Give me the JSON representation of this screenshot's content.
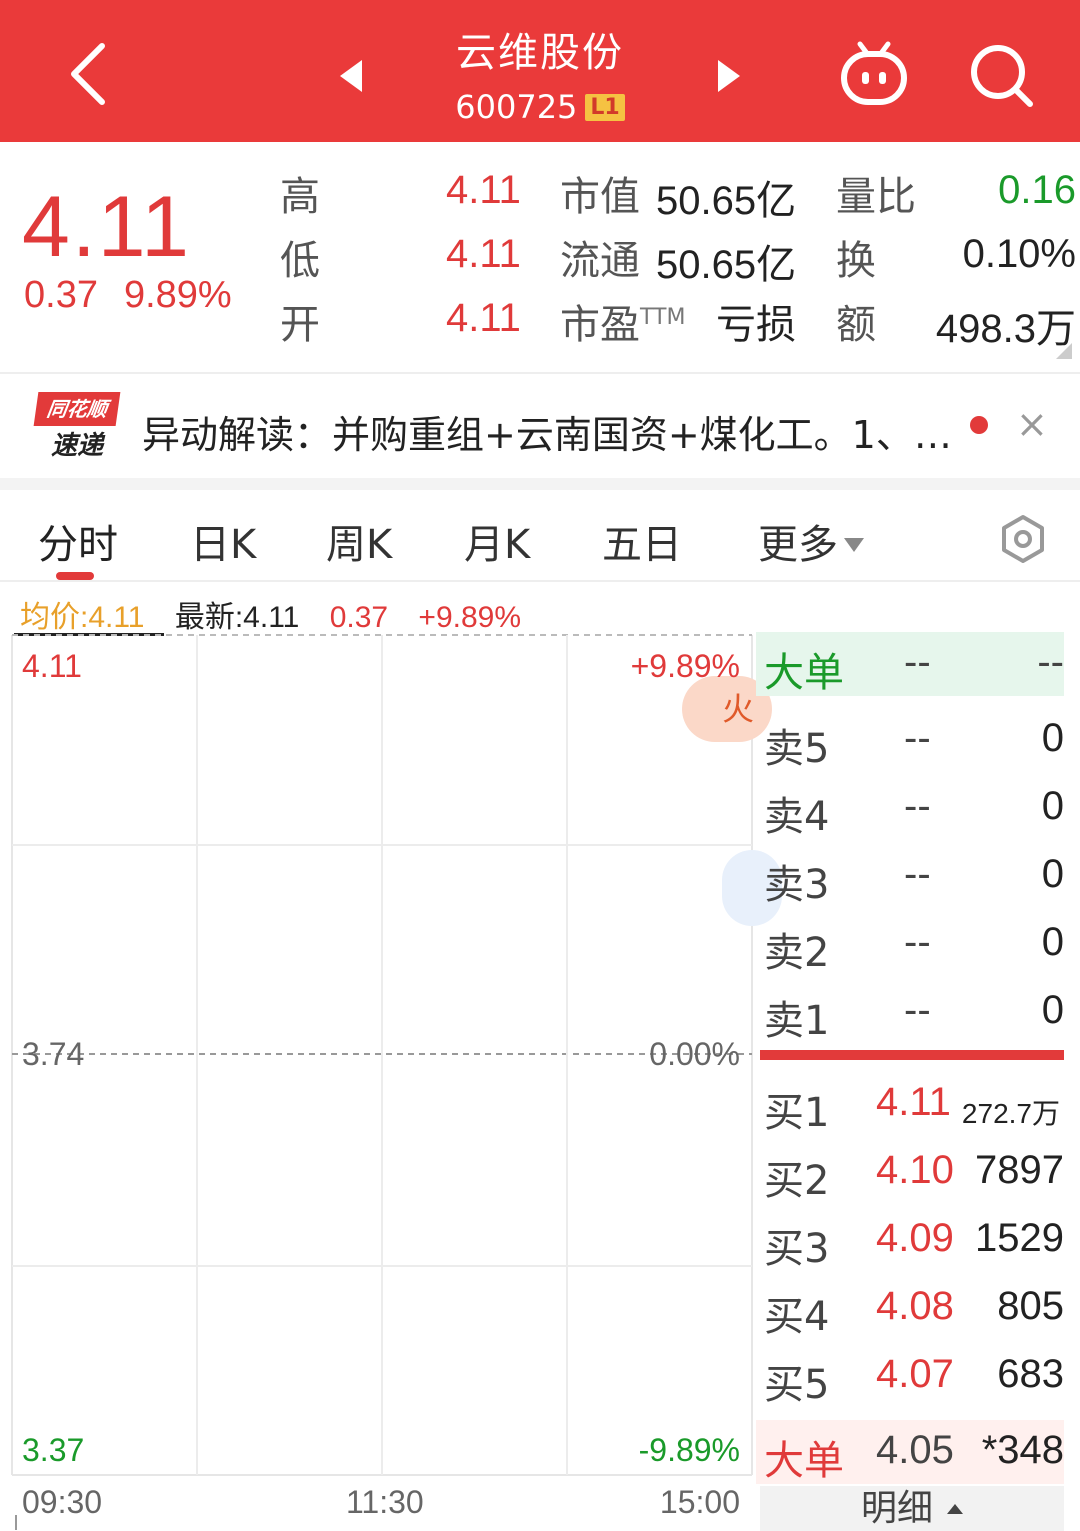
{
  "header": {
    "title": "云维股份",
    "code": "600725",
    "level": "L1"
  },
  "quote": {
    "price": "4.11",
    "change": "0.37",
    "change_pct": "9.89%",
    "high_label": "高",
    "high": "4.11",
    "low_label": "低",
    "low": "4.11",
    "open_label": "开",
    "open": "4.11",
    "mktcap_label": "市值",
    "mktcap": "50.65亿",
    "float_label": "流通",
    "float": "50.65亿",
    "pe_label": "市盈",
    "pe_sup": "TTM",
    "pe": "亏损",
    "volratio_label": "量比",
    "volratio": "0.16",
    "turnover_label": "换",
    "turnover": "0.10%",
    "amount_label": "额",
    "amount": "498.3万"
  },
  "news": {
    "logo_top": "同花顺",
    "logo_bottom": "速递",
    "text": "异动解读：并购重组+云南国资+煤化工。1、…",
    "close": "×"
  },
  "tabs": [
    {
      "label": "分时",
      "active": true
    },
    {
      "label": "日K"
    },
    {
      "label": "周K"
    },
    {
      "label": "月K"
    },
    {
      "label": "五日"
    },
    {
      "label": "更多"
    }
  ],
  "info": {
    "avg": "均价:4.11",
    "latest": "最新:4.11",
    "change": "0.37",
    "pct": "+9.89%"
  },
  "chart": {
    "price_top": "4.11",
    "price_mid": "3.74",
    "price_bot": "3.37",
    "pct_top": "+9.89%",
    "pct_mid": "0.00%",
    "pct_bot": "-9.89%",
    "time_start": "09:30",
    "time_mid": "11:30",
    "time_end": "15:00",
    "fire_char": "火"
  },
  "chart_data": {
    "type": "line",
    "x": [
      "09:30",
      "11:30",
      "15:00"
    ],
    "ylim": [
      3.37,
      4.11
    ],
    "reference": 3.74,
    "pct_range": [
      "-9.89%",
      "+9.89%"
    ],
    "series": []
  },
  "orderbook": {
    "header": {
      "label": "大单",
      "price": "--",
      "vol": "--"
    },
    "sells": [
      {
        "label": "卖5",
        "price": "--",
        "vol": "0"
      },
      {
        "label": "卖4",
        "price": "--",
        "vol": "0"
      },
      {
        "label": "卖3",
        "price": "--",
        "vol": "0"
      },
      {
        "label": "卖2",
        "price": "--",
        "vol": "0"
      },
      {
        "label": "卖1",
        "price": "--",
        "vol": "0"
      }
    ],
    "buys": [
      {
        "label": "买1",
        "price": "4.11",
        "vol": "272.7万"
      },
      {
        "label": "买2",
        "price": "4.10",
        "vol": "7897"
      },
      {
        "label": "买3",
        "price": "4.09",
        "vol": "1529"
      },
      {
        "label": "买4",
        "price": "4.08",
        "vol": "805"
      },
      {
        "label": "买5",
        "price": "4.07",
        "vol": "683"
      }
    ],
    "footer": {
      "label": "大单",
      "price": "4.05",
      "vol": "*348"
    },
    "detail_label": "明细"
  },
  "colors": {
    "header_bg": "#ea3a3a",
    "up_red": "#e03a3a",
    "down_green": "#1a9a2a",
    "avg_orange": "#e8a02a"
  }
}
